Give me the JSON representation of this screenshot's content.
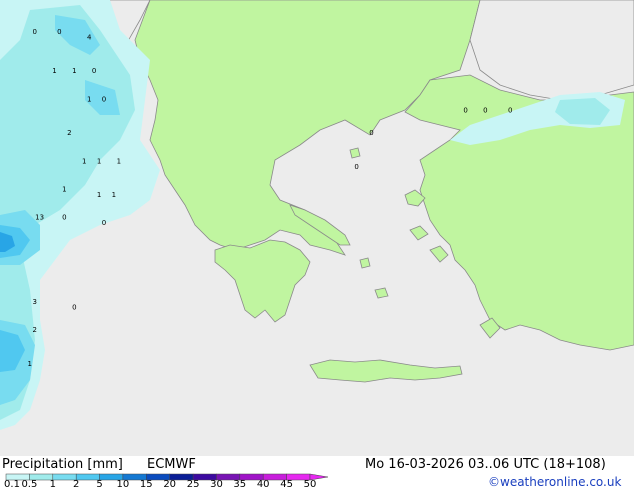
{
  "product": {
    "title": "Precipitation [mm]",
    "model": "ECMWF",
    "valid_time": "Mo 16-03-2026 03..06 UTC (18+108)",
    "credit": "©weatheronline.co.uk"
  },
  "legend": {
    "levels": [
      "0.1",
      "0.5",
      "1",
      "2",
      "5",
      "10",
      "15",
      "20",
      "25",
      "30",
      "35",
      "40",
      "45",
      "50"
    ],
    "colors": [
      "#c8f5f5",
      "#a0ebeb",
      "#78dcf0",
      "#50c8f0",
      "#28a5e6",
      "#1478d2",
      "#0a4bbe",
      "#0a1e96",
      "#3c0aa0",
      "#7814b4",
      "#a014c8",
      "#c81edc",
      "#e628f0"
    ]
  },
  "colors": {
    "sea": "#ececec",
    "land_in_domain": "#c0f5a0",
    "border": "#8a8a8a"
  },
  "precip_labels": [
    {
      "text": "0",
      "lon": 18.5,
      "lat": 42.2
    },
    {
      "text": "0",
      "lon": 19.0,
      "lat": 42.2
    },
    {
      "text": "4",
      "lon": 19.6,
      "lat": 42.1
    },
    {
      "text": "1",
      "lon": 18.9,
      "lat": 41.5
    },
    {
      "text": "1",
      "lon": 19.3,
      "lat": 41.5
    },
    {
      "text": "0",
      "lon": 19.7,
      "lat": 41.5
    },
    {
      "text": "1",
      "lon": 19.6,
      "lat": 41.0
    },
    {
      "text": "0",
      "lon": 19.9,
      "lat": 41.0
    },
    {
      "text": "2",
      "lon": 19.2,
      "lat": 40.4
    },
    {
      "text": "1",
      "lon": 19.5,
      "lat": 39.9
    },
    {
      "text": "1",
      "lon": 19.8,
      "lat": 39.9
    },
    {
      "text": "1",
      "lon": 20.2,
      "lat": 39.9
    },
    {
      "text": "1",
      "lon": 19.1,
      "lat": 39.4
    },
    {
      "text": "1",
      "lon": 19.8,
      "lat": 39.3
    },
    {
      "text": "1",
      "lon": 20.1,
      "lat": 39.3
    },
    {
      "text": "13",
      "lon": 18.6,
      "lat": 38.9
    },
    {
      "text": "0",
      "lon": 19.1,
      "lat": 38.9
    },
    {
      "text": "0",
      "lon": 19.9,
      "lat": 38.8
    },
    {
      "text": "3",
      "lon": 18.5,
      "lat": 37.4
    },
    {
      "text": "0",
      "lon": 19.3,
      "lat": 37.3
    },
    {
      "text": "2",
      "lon": 18.5,
      "lat": 36.9
    },
    {
      "text": "1",
      "lon": 18.4,
      "lat": 36.3
    },
    {
      "text": "0",
      "lon": 25.3,
      "lat": 40.4
    },
    {
      "text": "0",
      "lon": 25.0,
      "lat": 39.8
    },
    {
      "text": "0",
      "lon": 27.2,
      "lat": 40.8
    },
    {
      "text": "0",
      "lon": 27.6,
      "lat": 40.8
    },
    {
      "text": "0",
      "lon": 28.1,
      "lat": 40.8
    }
  ]
}
